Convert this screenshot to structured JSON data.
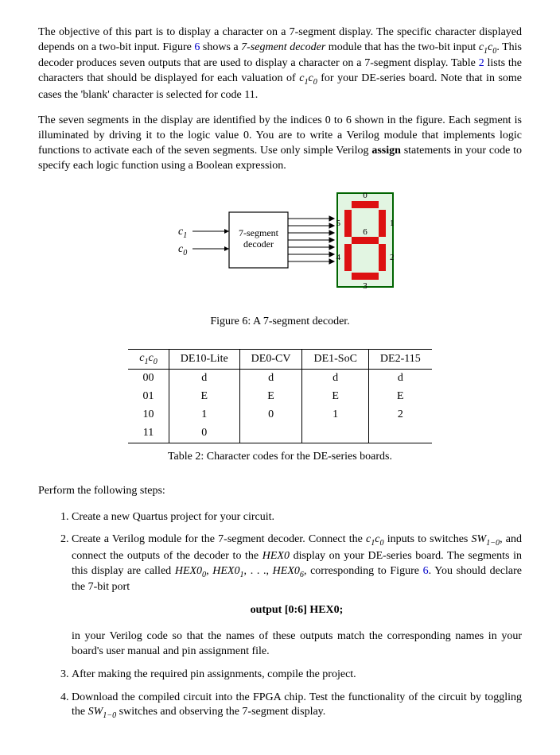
{
  "para1_a": "The objective of this part is to display a character on a 7-segment display. The specific character displayed depends on a two-bit input. Figure ",
  "fig_link_6": "6",
  "para1_b": " shows a ",
  "para1_c": "7-segment decoder",
  "para1_d": " module that has the two-bit input ",
  "c1": "c",
  "c1s": "1",
  "c0": "c",
  "c0s": "0",
  "para1_e": ". This decoder produces seven outputs that are used to display a character on a 7-segment display. Table ",
  "tab_link_2": "2",
  "para1_f": " lists the characters that should be displayed for each valuation of ",
  "para1_g": " for your DE-series board. Note that in some cases the 'blank' character is selected for code 11.",
  "para2_a": "The seven segments in the display are identified by the indices 0 to 6 shown in the figure. Each segment is illuminated by driving it to the logic value 0. You are to write a Verilog module that implements logic functions to activate each of the seven segments. Use only simple Verilog ",
  "assign": "assign",
  "para2_b": " statements in your code to specify each logic function using a Boolean expression.",
  "fig6": {
    "c1": "c",
    "c1s": "1",
    "c0": "c",
    "c0s": "0",
    "box_l1": "7-segment",
    "box_l2": "decoder",
    "d0": "0",
    "d1": "1",
    "d2": "2",
    "d3": "3",
    "d4": "4",
    "d5": "5",
    "d6": "6",
    "caption": "Figure 6: A 7-segment decoder."
  },
  "table": {
    "h0a": "c",
    "h0as": "1",
    "h0b": "c",
    "h0bs": "0",
    "h1": "DE10-Lite",
    "h2": "DE0-CV",
    "h3": "DE1-SoC",
    "h4": "DE2-115",
    "rows": [
      {
        "code": "00",
        "a": "d",
        "b": "d",
        "c": "d",
        "d": "d"
      },
      {
        "code": "01",
        "a": "E",
        "b": "E",
        "c": "E",
        "d": "E"
      },
      {
        "code": "10",
        "a": "1",
        "b": "0",
        "c": "1",
        "d": "2"
      },
      {
        "code": "11",
        "a": "0",
        "b": "",
        "c": "",
        "d": ""
      }
    ],
    "caption": "Table 2: Character codes for the DE-series boards."
  },
  "steps_intro": "Perform the following steps:",
  "step1": "Create a new Quartus project for your circuit.",
  "step2_a": "Create a Verilog module for the 7-segment decoder. Connect the ",
  "step2_b": " inputs to switches ",
  "sw": "SW",
  "sw_s": "1−0",
  "step2_c": ", and connect the outputs of the decoder to the ",
  "hex0i": "HEX0",
  "step2_d": " display on your DE-series board. The segments in this display are called ",
  "hexA": "HEX0",
  "hexAs": "0",
  "hexB": "HEX0",
  "hexBs": "1",
  "dots": ", . . ., ",
  "hexC": "HEX0",
  "hexCs": "6",
  "step2_e": ", corresponding to Figure ",
  "step2_f": ". You should declare the 7-bit port",
  "code_line": "output [0:6] HEX0;",
  "step2_post": "in your Verilog code so that the names of these outputs match the corresponding names in your board's user manual and pin assignment file.",
  "step3": "After making the required pin assignments, compile the project.",
  "step4_a": "Download the compiled circuit into the FPGA chip. Test the functionality of the circuit by toggling the ",
  "step4_b": " switches and observing the 7-segment display."
}
